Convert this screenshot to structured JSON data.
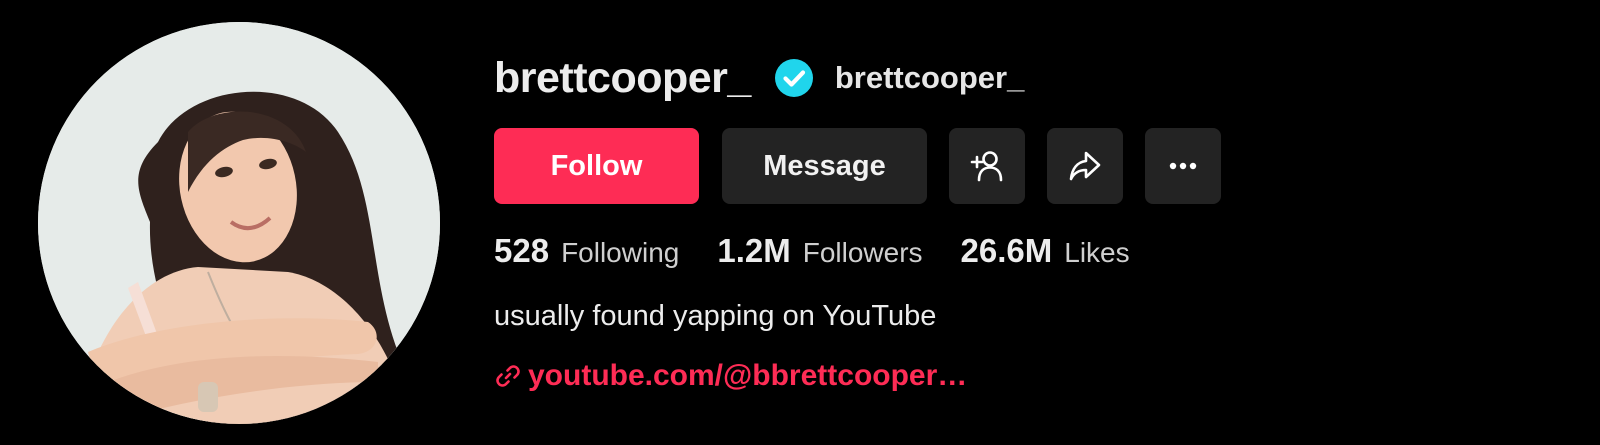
{
  "profile": {
    "username": "brettcooper_",
    "nickname": "brettcooper_",
    "verified": true,
    "bio": "usually found yapping on YouTube",
    "link": "youtube.com/@bbrettcooper…"
  },
  "buttons": {
    "follow_label": "Follow",
    "message_label": "Message"
  },
  "stats": [
    {
      "value": "528",
      "label": "Following"
    },
    {
      "value": "1.2M",
      "label": "Followers"
    },
    {
      "value": "26.6M",
      "label": "Likes"
    }
  ],
  "icons": {
    "verified": "verified-badge-icon",
    "suggest": "add-user-icon",
    "share": "share-arrow-icon",
    "more": "more-dots-icon",
    "link": "link-chain-icon"
  },
  "colors": {
    "background": "#000000",
    "accent": "#fe2c55",
    "verified": "#20d5ec",
    "button_secondary": "#232323"
  }
}
